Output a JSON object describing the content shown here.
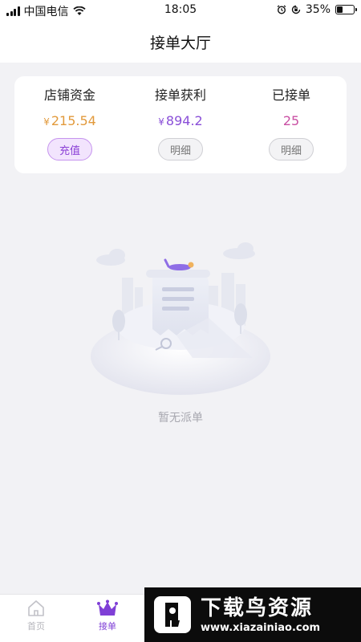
{
  "status_bar": {
    "carrier": "中国电信",
    "time": "18:05",
    "battery_percent": "35%",
    "battery_level": 0.35
  },
  "nav": {
    "title": "接单大厅"
  },
  "stats": [
    {
      "label": "店铺资金",
      "currency": "¥",
      "value": "215.54",
      "value_color": "#e29a3c",
      "button": "充值",
      "button_style": "primary"
    },
    {
      "label": "接单获利",
      "currency": "¥",
      "value": "894.2",
      "value_color": "#8a4fd8",
      "button": "明细",
      "button_style": "secondary"
    },
    {
      "label": "已接单",
      "currency": "",
      "value": "25",
      "value_color": "#c94fa3",
      "button": "明细",
      "button_style": "secondary"
    }
  ],
  "empty_state": {
    "text": "暂无派单",
    "icon": "empty-orders-illustration"
  },
  "tab_bar": {
    "items": [
      {
        "label": "首页",
        "icon": "home-icon",
        "active": false
      },
      {
        "label": "接单",
        "icon": "crown-icon",
        "active": true
      }
    ],
    "active_color": "#7f3fd6"
  },
  "watermark": {
    "title": "下载鸟资源",
    "url": "www.xiazainiao.com"
  }
}
